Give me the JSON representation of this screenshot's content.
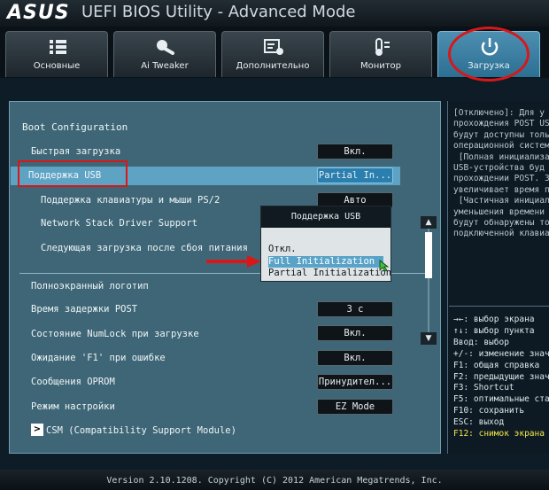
{
  "header": {
    "brand": "ASUS",
    "title": "UEFI BIOS Utility - Advanced Mode"
  },
  "tabs": [
    {
      "label": "Основные",
      "icon": "list-icon"
    },
    {
      "label": "Ai Tweaker",
      "icon": "tweaker-icon"
    },
    {
      "label": "Дополнительно",
      "icon": "advanced-icon"
    },
    {
      "label": "Монитор",
      "icon": "monitor-icon"
    },
    {
      "label": "Загрузка",
      "icon": "power-icon",
      "active": true
    }
  ],
  "main": {
    "section_title": "Boot Configuration",
    "rows": {
      "fast_boot": {
        "label": "Быстрая загрузка",
        "value": "Вкл."
      },
      "usb_support": {
        "label": "Поддержка USB",
        "value": "Partial In..."
      },
      "ps2_support": {
        "label": "Поддержка клавиатуры и мыши PS/2",
        "value": "Авто"
      },
      "network_stack": {
        "label": "Network Stack Driver Support"
      },
      "next_boot": {
        "label": "Следующая загрузка после сбоя питания"
      },
      "fullscreen_logo": {
        "label": "Полноэкранный логотип"
      },
      "post_delay": {
        "label": "Время задержки POST",
        "value": "3 с"
      },
      "numlock": {
        "label": "Состояние NumLock при загрузке",
        "value": "Вкл."
      },
      "wait_f1": {
        "label": "Ожидание 'F1' при ошибке",
        "value": "Вкл."
      },
      "oprom": {
        "label": "Сообщения OPROM",
        "value": "Принудител..."
      },
      "setup_mode": {
        "label": "Режим настройки",
        "value": "EZ Mode"
      },
      "csm": {
        "label": "CSM (Compatibility Support Module)"
      }
    }
  },
  "popup": {
    "title": "Поддержка USB",
    "options": [
      "Откл.",
      "Full Initialization",
      "Partial Initialization"
    ],
    "selected": "Full Initialization"
  },
  "help": {
    "text": "[Отключено]: Для у\nпрохождения POST US\nбудут доступны толь\nоперационной систем\n [Полная инициализа\nUSB-устройства буд\nпрохождении POST. З\nувеличивает время п\n [Частичная инициал\nуменьшения времени \nбудут обнаружены то\nподключенной клавиа",
    "keys": [
      "→←: выбор экрана",
      "↑↓: выбор пункта",
      "Ввод: выбор",
      "+/-: изменение знач",
      "F1: общая справка",
      "F2: предыдущие знач",
      "F3: Shortcut",
      "F5: оптимальные ста",
      "F10: сохранить",
      "ESC: выход",
      "F12: снимок экрана"
    ]
  },
  "footer": {
    "text": "Version 2.10.1208. Copyright (C) 2012 American Megatrends, Inc."
  },
  "colors": {
    "panel": "#3f6676",
    "selection": "#5fa3c4",
    "annotation": "#d81818",
    "highlight_key": "#f2e64a"
  }
}
